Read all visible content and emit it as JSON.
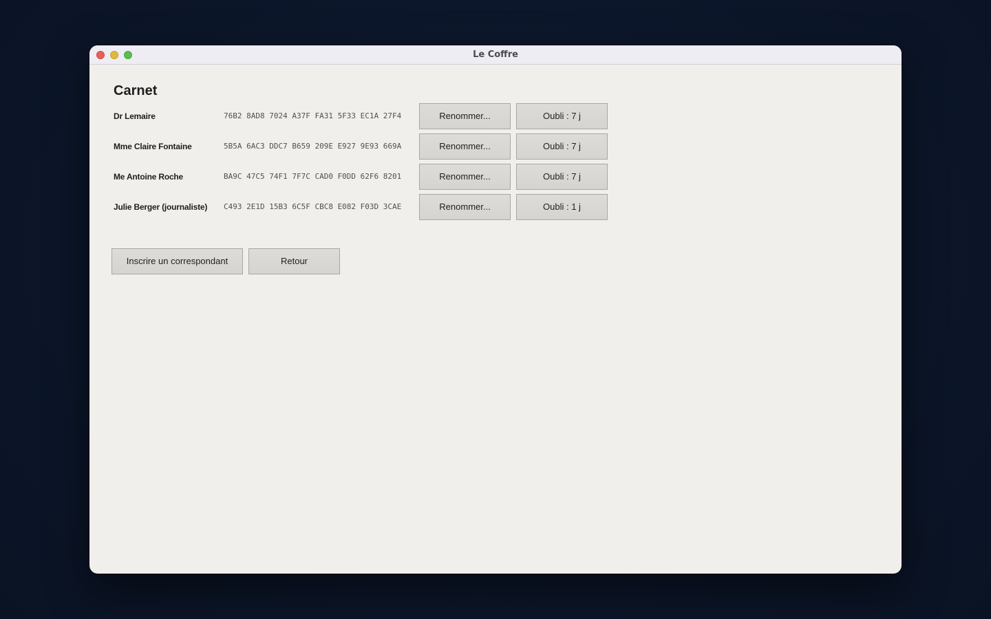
{
  "window": {
    "title": "Le Coffre"
  },
  "page": {
    "heading": "Carnet"
  },
  "contacts": [
    {
      "name": "Dr Lemaire",
      "fingerprint": "76B2 8AD8 7024 A37F FA31 5F33 EC1A 27F4",
      "rename_label": "Renommer...",
      "forget_label": "Oubli : 7 j"
    },
    {
      "name": "Mme Claire Fontaine",
      "fingerprint": "5B5A 6AC3 DDC7 B659 209E E927 9E93 669A",
      "rename_label": "Renommer...",
      "forget_label": "Oubli : 7 j"
    },
    {
      "name": "Me Antoine Roche",
      "fingerprint": "BA9C 47C5 74F1 7F7C CAD0 F0DD 62F6 8201",
      "rename_label": "Renommer...",
      "forget_label": "Oubli : 7 j"
    },
    {
      "name": "Julie Berger (journaliste)",
      "fingerprint": "C493 2E1D 15B3 6C5F CBC8 E082 F03D 3CAE",
      "rename_label": "Renommer...",
      "forget_label": "Oubli : 1 j"
    }
  ],
  "actions": {
    "register_label": "Inscrire un correspondant",
    "back_label": "Retour"
  },
  "colors": {
    "background": "#0c1629",
    "window": "#f0efec",
    "button": "#d9d7d3",
    "close": "#ec5f57",
    "minimize": "#e0b83a",
    "maximize": "#5dbd4c"
  }
}
